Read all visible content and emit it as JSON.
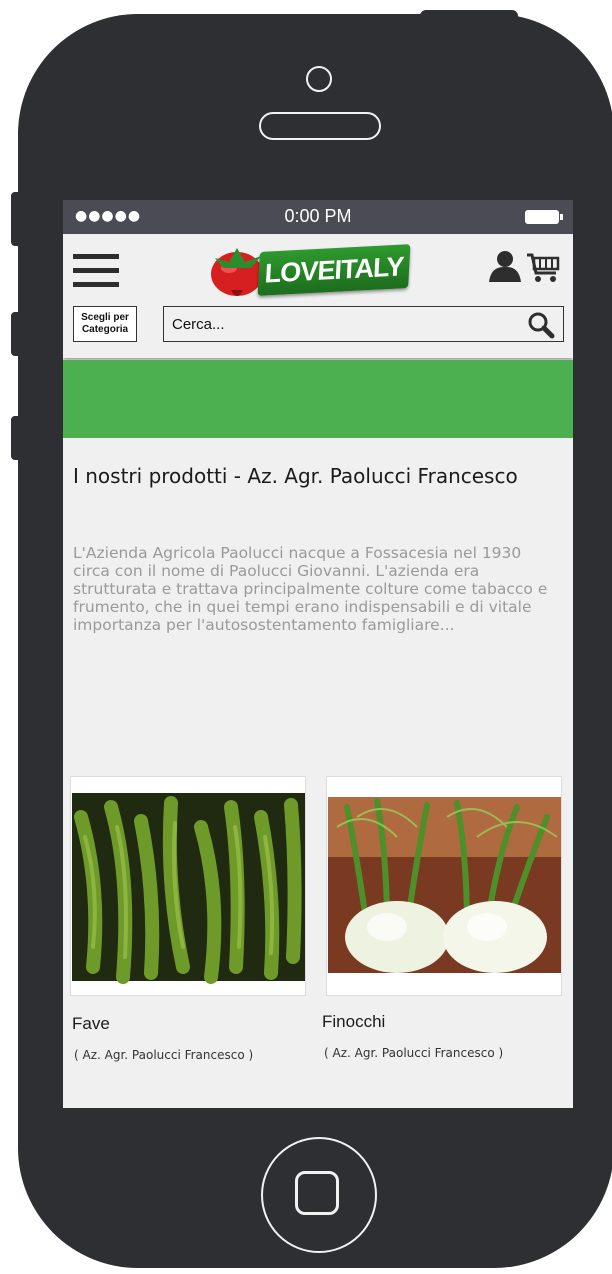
{
  "status_bar": {
    "signal": "●●●●●",
    "time": "0:00 PM"
  },
  "header": {
    "logo_text": "LOVEITALY",
    "category_button": {
      "line1": "Scegli per",
      "line2": "Categoria"
    },
    "search": {
      "placeholder": "Cerca..."
    }
  },
  "page": {
    "title": "I nostri prodotti - Az. Agr. Paolucci Francesco",
    "description": "L'Azienda Agricola Paolucci nacque a Fossacesia nel 1930 circa con il nome di Paolucci Giovanni. L'azienda era strutturata e trattava principalmente colture come tabacco e frumento, che in quei tempi erano indispensabili e di vitale importanza per l'autosostentamento famigliare..."
  },
  "products": [
    {
      "name": "Fave",
      "farm": "( Az. Agr. Paolucci Francesco )"
    },
    {
      "name": "Finocchi",
      "farm": "( Az. Agr. Paolucci Francesco )"
    }
  ],
  "colors": {
    "accent_green": "#4caf50",
    "phone_body": "#2d2f33",
    "status_bar": "#4a4b55"
  },
  "icons": [
    "menu-icon",
    "user-icon",
    "cart-icon",
    "search-icon"
  ]
}
